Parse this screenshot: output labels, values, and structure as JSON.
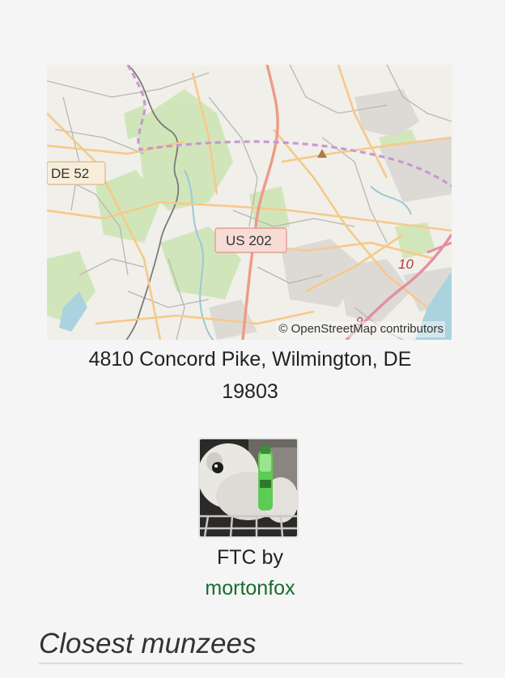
{
  "map": {
    "attribution": "© OpenStreetMap contributors",
    "road_labels": {
      "de52": "DE 52",
      "us202": "US 202",
      "exit10": "10",
      "exit9": "9"
    }
  },
  "location": {
    "address_line1": "4810 Concord Pike, Wilmington, DE",
    "address_line2": "19803"
  },
  "deploy": {
    "type_label": "FTC by",
    "username": "mortonfox"
  },
  "section": {
    "closest_title": "Closest munzees"
  }
}
